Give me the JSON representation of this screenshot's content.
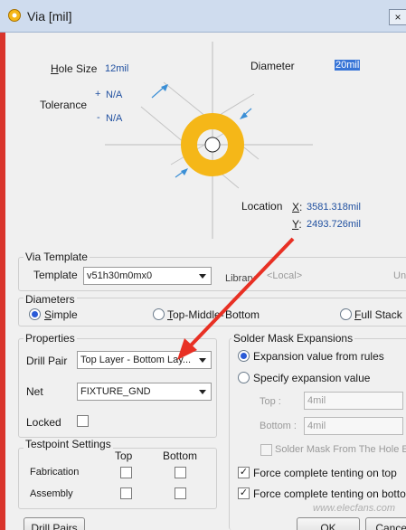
{
  "window": {
    "title": "Via [mil]",
    "close_glyph": "×"
  },
  "colors": {
    "via_ring": "#f5b718",
    "arrow": "#e83024",
    "accent": "#2a5bd7",
    "value_text": "#2050a0"
  },
  "diagram": {
    "hole_size_label": "Hole Size",
    "hole_size_value": "12mil",
    "tolerance_label": "Tolerance",
    "tol_plus_sign": "+",
    "tol_plus_value": "N/A",
    "tol_minus_sign": "-",
    "tol_minus_value": "N/A",
    "diameter_label": "Diameter",
    "diameter_value": "20mil",
    "location_label": "Location",
    "x_label": "X:",
    "x_value": "3581.318mil",
    "y_label": "Y:",
    "y_value": "2493.726mil"
  },
  "via_template": {
    "title": "Via Template",
    "template_label": "Template",
    "template_value": "v51h30m0mx0",
    "library_label": "Library",
    "library_value": "<Local>",
    "unlink_label": "Un"
  },
  "diameters": {
    "title": "Diameters",
    "options": [
      "Simple",
      "Top-Middle-Bottom",
      "Full Stack"
    ],
    "selected": "Simple"
  },
  "properties": {
    "title": "Properties",
    "drill_pair_label": "Drill Pair",
    "drill_pair_value": "Top Layer - Bottom Lay...",
    "net_label": "Net",
    "net_value": "FIXTURE_GND",
    "locked_label": "Locked"
  },
  "testpoint": {
    "title": "Testpoint Settings",
    "col_top": "Top",
    "col_bottom": "Bottom",
    "row_fabrication": "Fabrication",
    "row_assembly": "Assembly"
  },
  "solder_mask": {
    "title": "Solder Mask Expansions",
    "opt_rules": "Expansion value from rules",
    "opt_specify": "Specify expansion value",
    "top_label": "Top :",
    "top_value": "4mil",
    "bottom_label": "Bottom :",
    "bottom_value": "4mil",
    "from_hole_edge": "Solder Mask From The Hole Edge",
    "tent_top": "Force complete tenting on top",
    "tent_bottom": "Force complete tenting on bottom"
  },
  "buttons": {
    "drill_pairs": "Drill Pairs",
    "ok": "OK",
    "cancel": "Cancel"
  },
  "watermark": "www.elecfans.com"
}
